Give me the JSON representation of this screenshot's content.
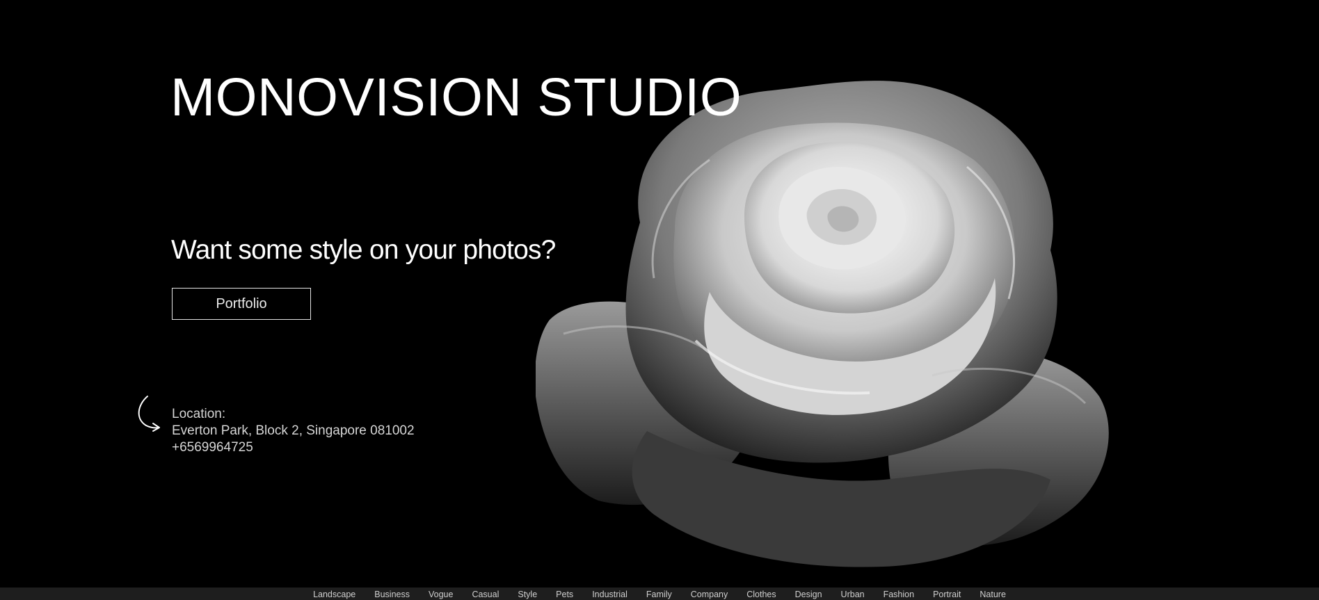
{
  "header": {
    "title": "MONOVISION STUDIO"
  },
  "hero": {
    "tagline": "Want some style on your photos?",
    "button_label": "Portfolio",
    "image_icon": "rose-photo"
  },
  "location": {
    "label": "Location:",
    "address": "Everton Park, Block 2, Singapore 081002",
    "phone": "+6569964725",
    "icon": "curved-arrow-icon"
  },
  "footer": {
    "nav": [
      "Landscape",
      "Business",
      "Vogue",
      "Casual",
      "Style",
      "Pets",
      "Industrial",
      "Family",
      "Company",
      "Clothes",
      "Design",
      "Urban",
      "Fashion",
      "Portrait",
      "Nature"
    ]
  },
  "colors": {
    "background": "#000000",
    "text": "#ffffff",
    "footer_bg": "#1e1e1e"
  }
}
